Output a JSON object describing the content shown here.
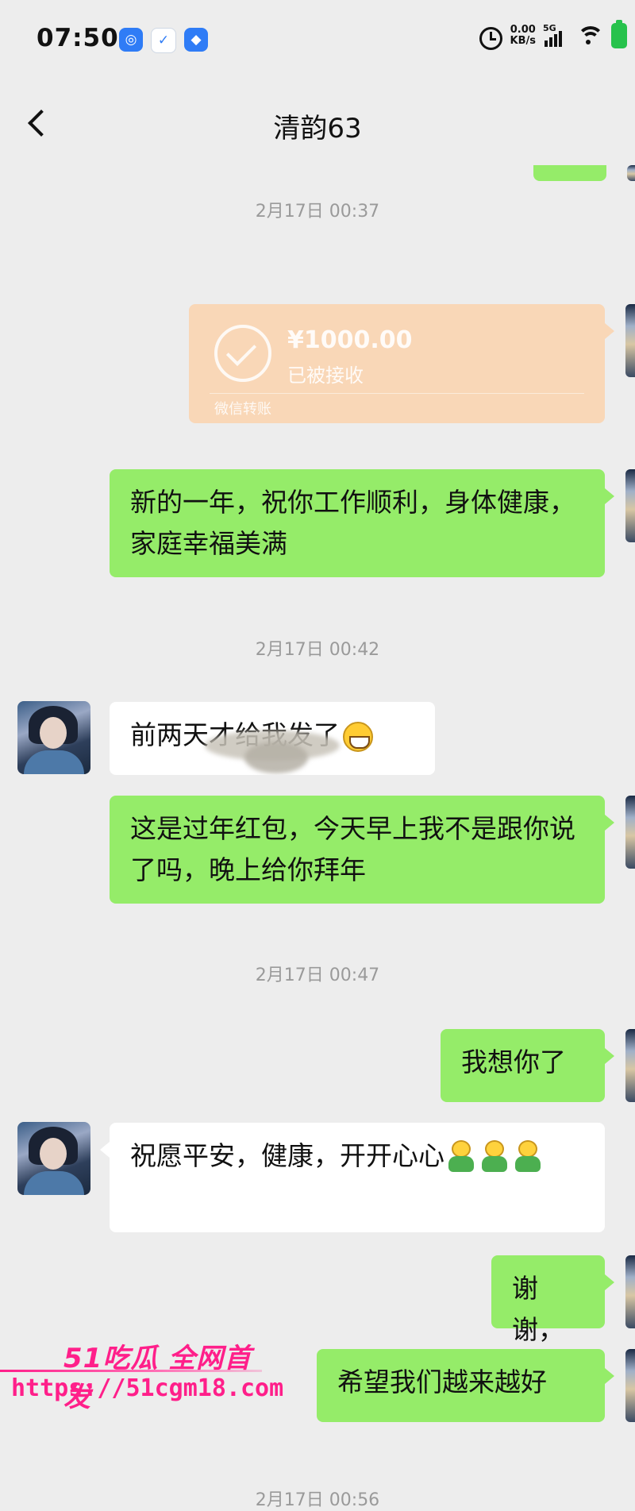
{
  "status_bar": {
    "time": "07:50",
    "net_speed_value": "0.00",
    "net_speed_unit": "KB/s",
    "network": "5G",
    "battery_color": "#27c24c"
  },
  "header": {
    "title": "清韵63"
  },
  "messages": {
    "ts1": "2月17日 00:37",
    "transfer_amount": "¥1000.00",
    "transfer_status": "已被接收",
    "transfer_footer": "微信转账",
    "m1": "新的一年，祝你工作顺利，身体健康，家庭幸福美满",
    "ts2": "2月17日 00:42",
    "m2": "前两天才给我发了",
    "m3": "这是过年红包，今天早上我不是跟你说了吗，晚上给你拜年",
    "ts3": "2月17日 00:47",
    "m4": "我想你了",
    "m5": "祝愿平安，健康，开开心心",
    "m6": "谢谢，",
    "m7": "希望我们越来越好",
    "ts4": "2月17日 00:56"
  },
  "watermark": {
    "brand": "51吃瓜 全网首发",
    "url": "https://51cgm18.com"
  },
  "colors": {
    "self_bubble": "#95ec69",
    "other_bubble": "#ffffff",
    "transfer_card": "#f9d7b7",
    "watermark": "#ff1f8a"
  }
}
